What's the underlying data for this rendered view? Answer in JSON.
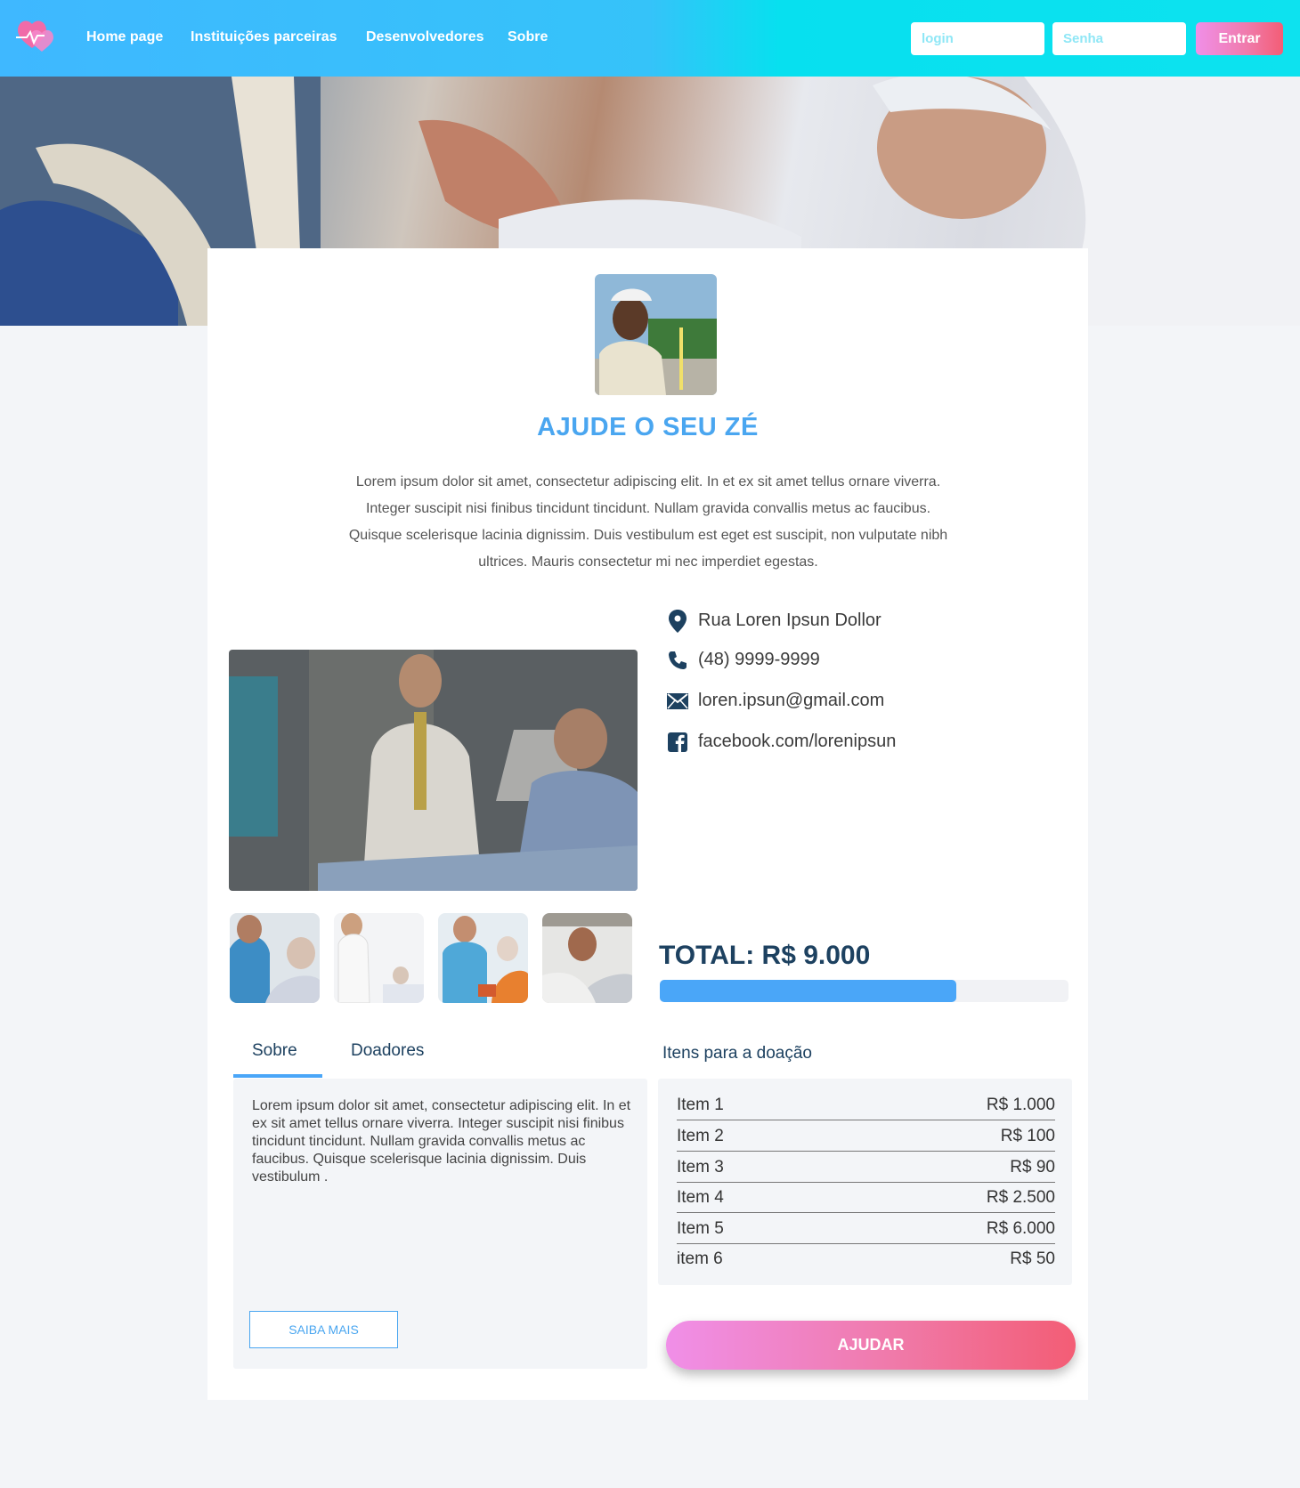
{
  "header": {
    "logo_icon": "heart-logo-icon",
    "nav": [
      {
        "label": "Home page"
      },
      {
        "label": "Instituições parceiras"
      },
      {
        "label": "Desenvolvedores"
      },
      {
        "label": "Sobre"
      }
    ],
    "login_placeholder": "login",
    "password_placeholder": "Senha",
    "enter_label": "Entrar"
  },
  "campaign": {
    "title": "AJUDE O SEU ZÉ",
    "intro": "Lorem ipsum dolor sit amet, consectetur adipiscing elit. In et ex sit amet tellus ornare viverra. Integer suscipit nisi finibus tincidunt tincidunt. Nullam gravida convallis metus ac faucibus. Quisque scelerisque lacinia dignissim. Duis vestibulum est eget est suscipit, non vulputate nibh ultrices. Mauris consectetur mi nec imperdiet egestas."
  },
  "contact": {
    "address": "Rua Loren Ipsun Dollor",
    "phone": "(48) 9999-9999",
    "email": "loren.ipsun@gmail.com",
    "facebook": "facebook.com/lorenipsun",
    "icons": [
      "map-pin-icon",
      "phone-icon",
      "envelope-icon",
      "facebook-icon"
    ]
  },
  "donation": {
    "total_label": "TOTAL: R$ 9.000",
    "progress_fraction": 0.725
  },
  "tabs": [
    {
      "label": "Sobre"
    },
    {
      "label": "Doadores"
    }
  ],
  "about": {
    "text": "Lorem ipsum dolor sit amet, consectetur adipiscing elit. In et ex sit amet tellus ornare viverra. Integer suscipit nisi finibus tincidunt tincidunt. Nullam gravida convallis metus ac faucibus. Quisque scelerisque lacinia dignissim. Duis vestibulum .",
    "more_label": "SAIBA MAIS"
  },
  "items": {
    "title": "Itens para a doação",
    "list": [
      {
        "name": "Item 1",
        "price": "R$ 1.000"
      },
      {
        "name": "Item 2",
        "price": "R$ 100"
      },
      {
        "name": "Item 3",
        "price": "R$ 90"
      },
      {
        "name": "Item 4",
        "price": "R$ 2.500"
      },
      {
        "name": "Item 5",
        "price": "R$ 6.000"
      },
      {
        "name": "item 6",
        "price": "R$ 50"
      }
    ]
  },
  "cta_label": "AJUDAR",
  "colors": {
    "accent_blue": "#4aa6f8",
    "title_blue": "#4aa6f0",
    "dark_navy": "#1d4160",
    "header_cyan": "#07e0ef",
    "cta_pink": "#f08fe8",
    "cta_red": "#f35d75"
  }
}
